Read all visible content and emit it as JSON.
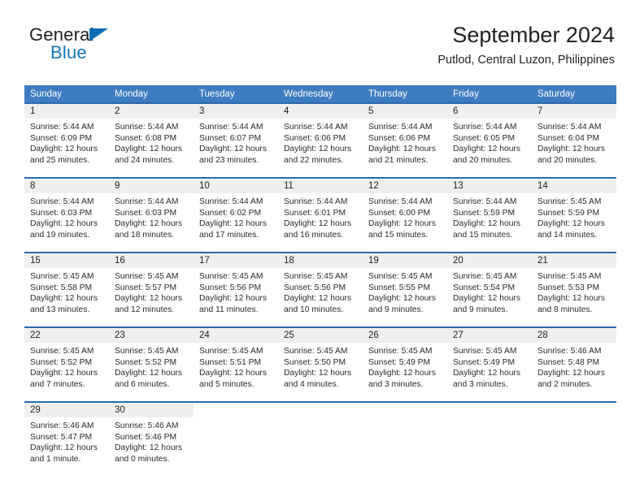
{
  "brand": {
    "name_part1": "General",
    "name_part2": "Blue",
    "triangle_icon": "triangle-icon",
    "accent_color": "#1576bc"
  },
  "header": {
    "title": "September 2024",
    "location": "Putlod, Central Luzon, Philippines"
  },
  "theme": {
    "header_row_color": "#3d7cc0",
    "week_divider_color": "#2c6aad",
    "daynum_band_color": "#efefef"
  },
  "weekdays": [
    "Sunday",
    "Monday",
    "Tuesday",
    "Wednesday",
    "Thursday",
    "Friday",
    "Saturday"
  ],
  "weeks": [
    [
      {
        "day": "1",
        "sunrise": "Sunrise: 5:44 AM",
        "sunset": "Sunset: 6:09 PM",
        "daylight1": "Daylight: 12 hours",
        "daylight2": "and 25 minutes."
      },
      {
        "day": "2",
        "sunrise": "Sunrise: 5:44 AM",
        "sunset": "Sunset: 6:08 PM",
        "daylight1": "Daylight: 12 hours",
        "daylight2": "and 24 minutes."
      },
      {
        "day": "3",
        "sunrise": "Sunrise: 5:44 AM",
        "sunset": "Sunset: 6:07 PM",
        "daylight1": "Daylight: 12 hours",
        "daylight2": "and 23 minutes."
      },
      {
        "day": "4",
        "sunrise": "Sunrise: 5:44 AM",
        "sunset": "Sunset: 6:06 PM",
        "daylight1": "Daylight: 12 hours",
        "daylight2": "and 22 minutes."
      },
      {
        "day": "5",
        "sunrise": "Sunrise: 5:44 AM",
        "sunset": "Sunset: 6:06 PM",
        "daylight1": "Daylight: 12 hours",
        "daylight2": "and 21 minutes."
      },
      {
        "day": "6",
        "sunrise": "Sunrise: 5:44 AM",
        "sunset": "Sunset: 6:05 PM",
        "daylight1": "Daylight: 12 hours",
        "daylight2": "and 20 minutes."
      },
      {
        "day": "7",
        "sunrise": "Sunrise: 5:44 AM",
        "sunset": "Sunset: 6:04 PM",
        "daylight1": "Daylight: 12 hours",
        "daylight2": "and 20 minutes."
      }
    ],
    [
      {
        "day": "8",
        "sunrise": "Sunrise: 5:44 AM",
        "sunset": "Sunset: 6:03 PM",
        "daylight1": "Daylight: 12 hours",
        "daylight2": "and 19 minutes."
      },
      {
        "day": "9",
        "sunrise": "Sunrise: 5:44 AM",
        "sunset": "Sunset: 6:03 PM",
        "daylight1": "Daylight: 12 hours",
        "daylight2": "and 18 minutes."
      },
      {
        "day": "10",
        "sunrise": "Sunrise: 5:44 AM",
        "sunset": "Sunset: 6:02 PM",
        "daylight1": "Daylight: 12 hours",
        "daylight2": "and 17 minutes."
      },
      {
        "day": "11",
        "sunrise": "Sunrise: 5:44 AM",
        "sunset": "Sunset: 6:01 PM",
        "daylight1": "Daylight: 12 hours",
        "daylight2": "and 16 minutes."
      },
      {
        "day": "12",
        "sunrise": "Sunrise: 5:44 AM",
        "sunset": "Sunset: 6:00 PM",
        "daylight1": "Daylight: 12 hours",
        "daylight2": "and 15 minutes."
      },
      {
        "day": "13",
        "sunrise": "Sunrise: 5:44 AM",
        "sunset": "Sunset: 5:59 PM",
        "daylight1": "Daylight: 12 hours",
        "daylight2": "and 15 minutes."
      },
      {
        "day": "14",
        "sunrise": "Sunrise: 5:45 AM",
        "sunset": "Sunset: 5:59 PM",
        "daylight1": "Daylight: 12 hours",
        "daylight2": "and 14 minutes."
      }
    ],
    [
      {
        "day": "15",
        "sunrise": "Sunrise: 5:45 AM",
        "sunset": "Sunset: 5:58 PM",
        "daylight1": "Daylight: 12 hours",
        "daylight2": "and 13 minutes."
      },
      {
        "day": "16",
        "sunrise": "Sunrise: 5:45 AM",
        "sunset": "Sunset: 5:57 PM",
        "daylight1": "Daylight: 12 hours",
        "daylight2": "and 12 minutes."
      },
      {
        "day": "17",
        "sunrise": "Sunrise: 5:45 AM",
        "sunset": "Sunset: 5:56 PM",
        "daylight1": "Daylight: 12 hours",
        "daylight2": "and 11 minutes."
      },
      {
        "day": "18",
        "sunrise": "Sunrise: 5:45 AM",
        "sunset": "Sunset: 5:56 PM",
        "daylight1": "Daylight: 12 hours",
        "daylight2": "and 10 minutes."
      },
      {
        "day": "19",
        "sunrise": "Sunrise: 5:45 AM",
        "sunset": "Sunset: 5:55 PM",
        "daylight1": "Daylight: 12 hours",
        "daylight2": "and 9 minutes."
      },
      {
        "day": "20",
        "sunrise": "Sunrise: 5:45 AM",
        "sunset": "Sunset: 5:54 PM",
        "daylight1": "Daylight: 12 hours",
        "daylight2": "and 9 minutes."
      },
      {
        "day": "21",
        "sunrise": "Sunrise: 5:45 AM",
        "sunset": "Sunset: 5:53 PM",
        "daylight1": "Daylight: 12 hours",
        "daylight2": "and 8 minutes."
      }
    ],
    [
      {
        "day": "22",
        "sunrise": "Sunrise: 5:45 AM",
        "sunset": "Sunset: 5:52 PM",
        "daylight1": "Daylight: 12 hours",
        "daylight2": "and 7 minutes."
      },
      {
        "day": "23",
        "sunrise": "Sunrise: 5:45 AM",
        "sunset": "Sunset: 5:52 PM",
        "daylight1": "Daylight: 12 hours",
        "daylight2": "and 6 minutes."
      },
      {
        "day": "24",
        "sunrise": "Sunrise: 5:45 AM",
        "sunset": "Sunset: 5:51 PM",
        "daylight1": "Daylight: 12 hours",
        "daylight2": "and 5 minutes."
      },
      {
        "day": "25",
        "sunrise": "Sunrise: 5:45 AM",
        "sunset": "Sunset: 5:50 PM",
        "daylight1": "Daylight: 12 hours",
        "daylight2": "and 4 minutes."
      },
      {
        "day": "26",
        "sunrise": "Sunrise: 5:45 AM",
        "sunset": "Sunset: 5:49 PM",
        "daylight1": "Daylight: 12 hours",
        "daylight2": "and 3 minutes."
      },
      {
        "day": "27",
        "sunrise": "Sunrise: 5:45 AM",
        "sunset": "Sunset: 5:49 PM",
        "daylight1": "Daylight: 12 hours",
        "daylight2": "and 3 minutes."
      },
      {
        "day": "28",
        "sunrise": "Sunrise: 5:46 AM",
        "sunset": "Sunset: 5:48 PM",
        "daylight1": "Daylight: 12 hours",
        "daylight2": "and 2 minutes."
      }
    ],
    [
      {
        "day": "29",
        "sunrise": "Sunrise: 5:46 AM",
        "sunset": "Sunset: 5:47 PM",
        "daylight1": "Daylight: 12 hours",
        "daylight2": "and 1 minute."
      },
      {
        "day": "30",
        "sunrise": "Sunrise: 5:46 AM",
        "sunset": "Sunset: 5:46 PM",
        "daylight1": "Daylight: 12 hours",
        "daylight2": "and 0 minutes."
      },
      {
        "day": "",
        "sunrise": "",
        "sunset": "",
        "daylight1": "",
        "daylight2": ""
      },
      {
        "day": "",
        "sunrise": "",
        "sunset": "",
        "daylight1": "",
        "daylight2": ""
      },
      {
        "day": "",
        "sunrise": "",
        "sunset": "",
        "daylight1": "",
        "daylight2": ""
      },
      {
        "day": "",
        "sunrise": "",
        "sunset": "",
        "daylight1": "",
        "daylight2": ""
      },
      {
        "day": "",
        "sunrise": "",
        "sunset": "",
        "daylight1": "",
        "daylight2": ""
      }
    ]
  ]
}
